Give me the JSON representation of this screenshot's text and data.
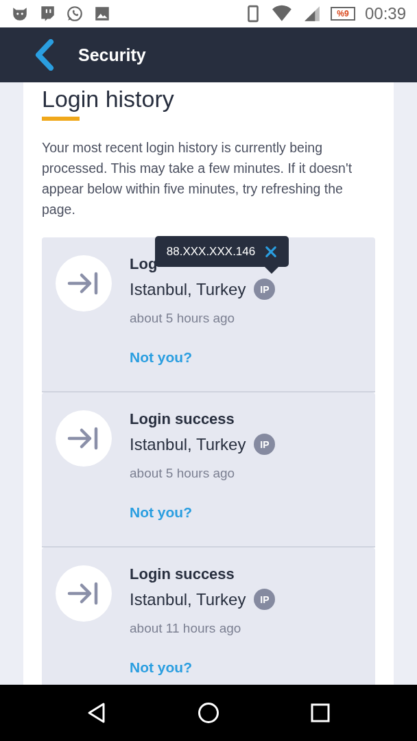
{
  "status_bar": {
    "battery": "%9",
    "time": "00:39"
  },
  "header": {
    "title": "Security"
  },
  "section": {
    "title": "Login history",
    "message": "Your most recent login history is currently being processed. This may take a few minutes. If it doesn't appear below within five minutes, try refreshing the page."
  },
  "tooltip": {
    "ip": "88.XXX.XXX.146"
  },
  "logins": [
    {
      "title": "Log",
      "location": "Istanbul, Turkey",
      "ip_badge": "IP",
      "time": "about 5 hours ago",
      "link": "Not you?"
    },
    {
      "title": "Login success",
      "location": "Istanbul, Turkey",
      "ip_badge": "IP",
      "time": "about 5 hours ago",
      "link": "Not you?"
    },
    {
      "title": "Login success",
      "location": "Istanbul, Turkey",
      "ip_badge": "IP",
      "time": "about 11 hours ago",
      "link": "Not you?"
    }
  ]
}
